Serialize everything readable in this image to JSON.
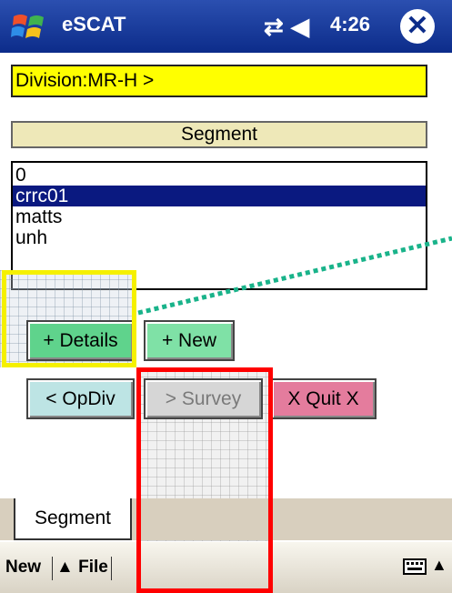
{
  "titlebar": {
    "title": "eSCAT",
    "time": "4:26"
  },
  "division": {
    "label": "Division:MR-H >"
  },
  "segment_header": "Segment",
  "segment_list": [
    "0",
    "crrc01",
    "matts",
    "unh"
  ],
  "buttons": {
    "details": "+ Details",
    "new": "+ New",
    "opdiv": "< OpDiv",
    "survey": "> Survey",
    "quit": "X Quit X"
  },
  "tabs": {
    "segment": "Segment"
  },
  "menubar": {
    "new": "New",
    "file": "▲ File"
  },
  "colors": {
    "division_bg": "#ffff00",
    "selected_item": "#0a1980",
    "details_btn": "#5fd38c",
    "quit_btn": "#e47c9d"
  }
}
